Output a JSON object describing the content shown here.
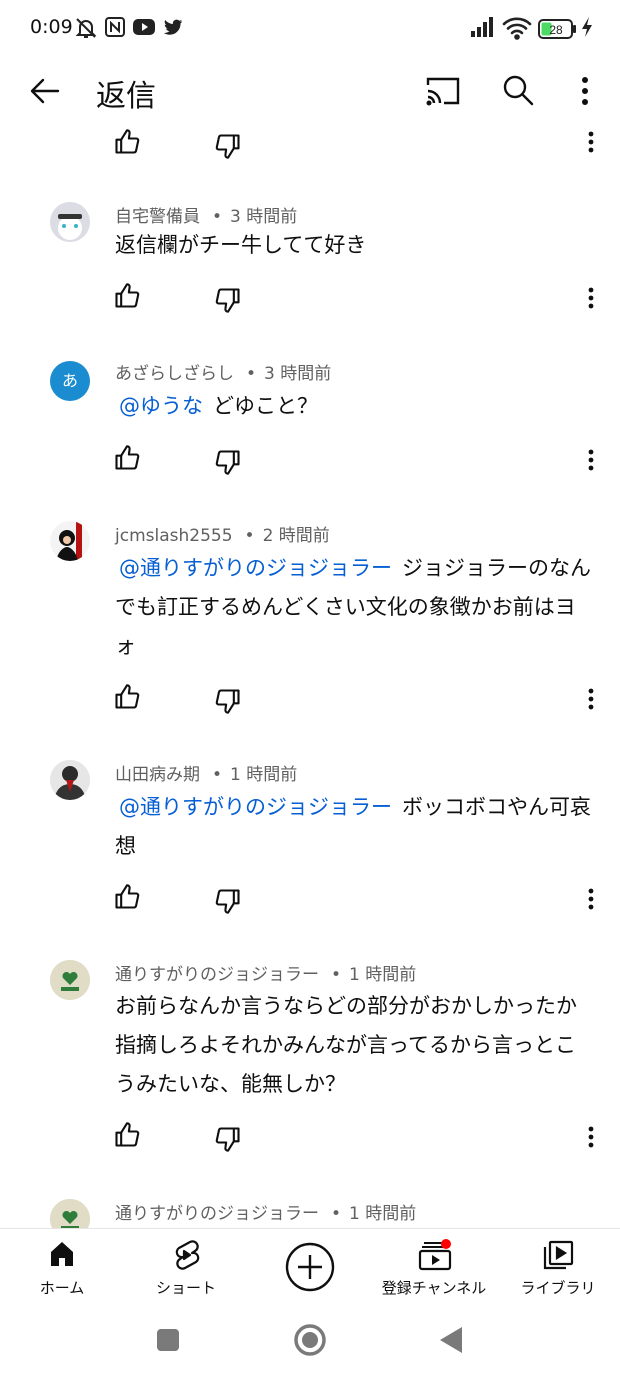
{
  "status_bar": {
    "time": "0:09",
    "battery": "28"
  },
  "app_bar": {
    "title": "返信"
  },
  "comments": [
    {
      "author": "自宅警備員",
      "time": "3 時間前",
      "mention": "",
      "text": "返信欄がチー牛してて好き"
    },
    {
      "author": "あざらしざらし",
      "avatar_letter": "あ",
      "time": "3 時間前",
      "mention": "@ゆうな",
      "text": "どゆこと？"
    },
    {
      "author": "jcmslash2555",
      "time": "2 時間前",
      "mention": "@通りすがりのジョジョラー",
      "text": "ジョジョラーのなんでも訂正するめんどくさい文化の象徴かお前はヨォ"
    },
    {
      "author": "山田病み期",
      "time": "1 時間前",
      "mention": "@通りすがりのジョジョラー",
      "text": "ボッコボコやん可哀想"
    },
    {
      "author": "通りすがりのジョジョラー",
      "time": "1 時間前",
      "mention": "",
      "text": "お前らなんか言うならどの部分がおかしかったか指摘しろよそれかみんなが言ってるから言っとこうみたいな、能無しか？"
    },
    {
      "author": "通りすがりのジョジョラー",
      "time": "1 時間前",
      "mention": "",
      "text": ""
    }
  ],
  "bottom_nav": [
    {
      "label": "ホーム",
      "icon": "home-icon"
    },
    {
      "label": "ショート",
      "icon": "shorts-icon"
    },
    {
      "label": "",
      "icon": "create-icon"
    },
    {
      "label": "登録チャンネル",
      "icon": "subscriptions-icon"
    },
    {
      "label": "ライブラリ",
      "icon": "library-icon"
    }
  ],
  "colors": {
    "link": "#065fd4",
    "meta": "#606060",
    "notification_dot": "#ff0000",
    "battery_fill": "#4cd964"
  }
}
